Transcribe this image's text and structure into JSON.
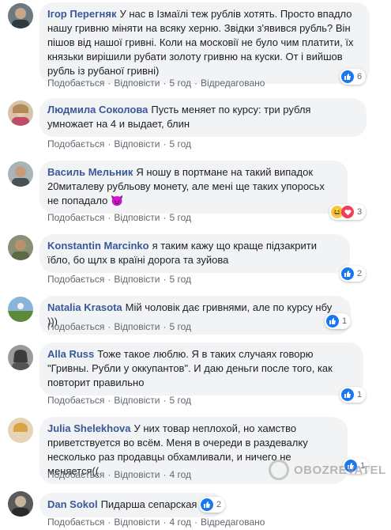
{
  "comments": [
    {
      "author": "Ігор Перегняк",
      "text": "У нас в Ізмаїлі теж рублів хотять. Просто впадло нашу гривню міняти на всяку херню. Звідки з'явився рубль? Він пішов від нашої гривні. Коли на московії не було чим платити, їх князьки вирішили рубати золоту гривню на куски. От і вийшов рубль із рубаної гривні)",
      "like": "Подобається",
      "reply": "Відповісти",
      "time": "5 год",
      "edited": "Відредаговано",
      "reactions": "6"
    },
    {
      "author": "Людмила Соколова",
      "text": "Пусть меняет по курсу: три рубля умножает на 4 и выдает, блин",
      "like": "Подобається",
      "reply": "Відповісти",
      "time": "5 год"
    },
    {
      "author": "Василь Мельник",
      "text": "Я ношу в портмане на такий випадок 20миталеву рубльову монету, але мені ще таких упоросьх не попадало 😈",
      "like": "Подобається",
      "reply": "Відповісти",
      "time": "5 год",
      "reactions": "3"
    },
    {
      "author": "Konstantin Marcinko",
      "text": "я таким кажу що краще підзакрити їбло, бо щлх в країні дорога та зуйова",
      "like": "Подобається",
      "reply": "Відповісти",
      "time": "5 год",
      "reactions": "2"
    },
    {
      "author": "Natalia Krasota",
      "text": "Мій чоловік дає гривнями, але по курсу нбу )))",
      "like": "Подобається",
      "reply": "Відповісти",
      "time": "5 год",
      "reactions": "1"
    },
    {
      "author": "Alla Russ",
      "text": "Тоже такое люблю. Я в таких случаях говорю \"Гривны. Рубли у оккупантов\". И даю деньги после того, как повторит правильно",
      "like": "Подобається",
      "reply": "Відповісти",
      "time": "5 год",
      "reactions": "1"
    },
    {
      "author": "Julia Shelekhova",
      "text": "У них товар неплохой, но хамство приветствуется во всём. Меня в очереди в раздевалку несколько раз продавцы обхамливали, и ничего не меняется((",
      "like": "Подобається",
      "reply": "Відповісти",
      "time": "4 год",
      "reactions": "1"
    },
    {
      "author": "Dan Sokol",
      "text": "Пидарша сепарская",
      "like": "Подобається",
      "reply": "Відповісти",
      "time": "4 год",
      "edited": "Відредаговано",
      "reactions": "2"
    }
  ],
  "watermark": "OBOZREVATEL",
  "colors": {
    "author": "#385898",
    "bubble": "#f2f3f5",
    "like": "#1877f2"
  }
}
